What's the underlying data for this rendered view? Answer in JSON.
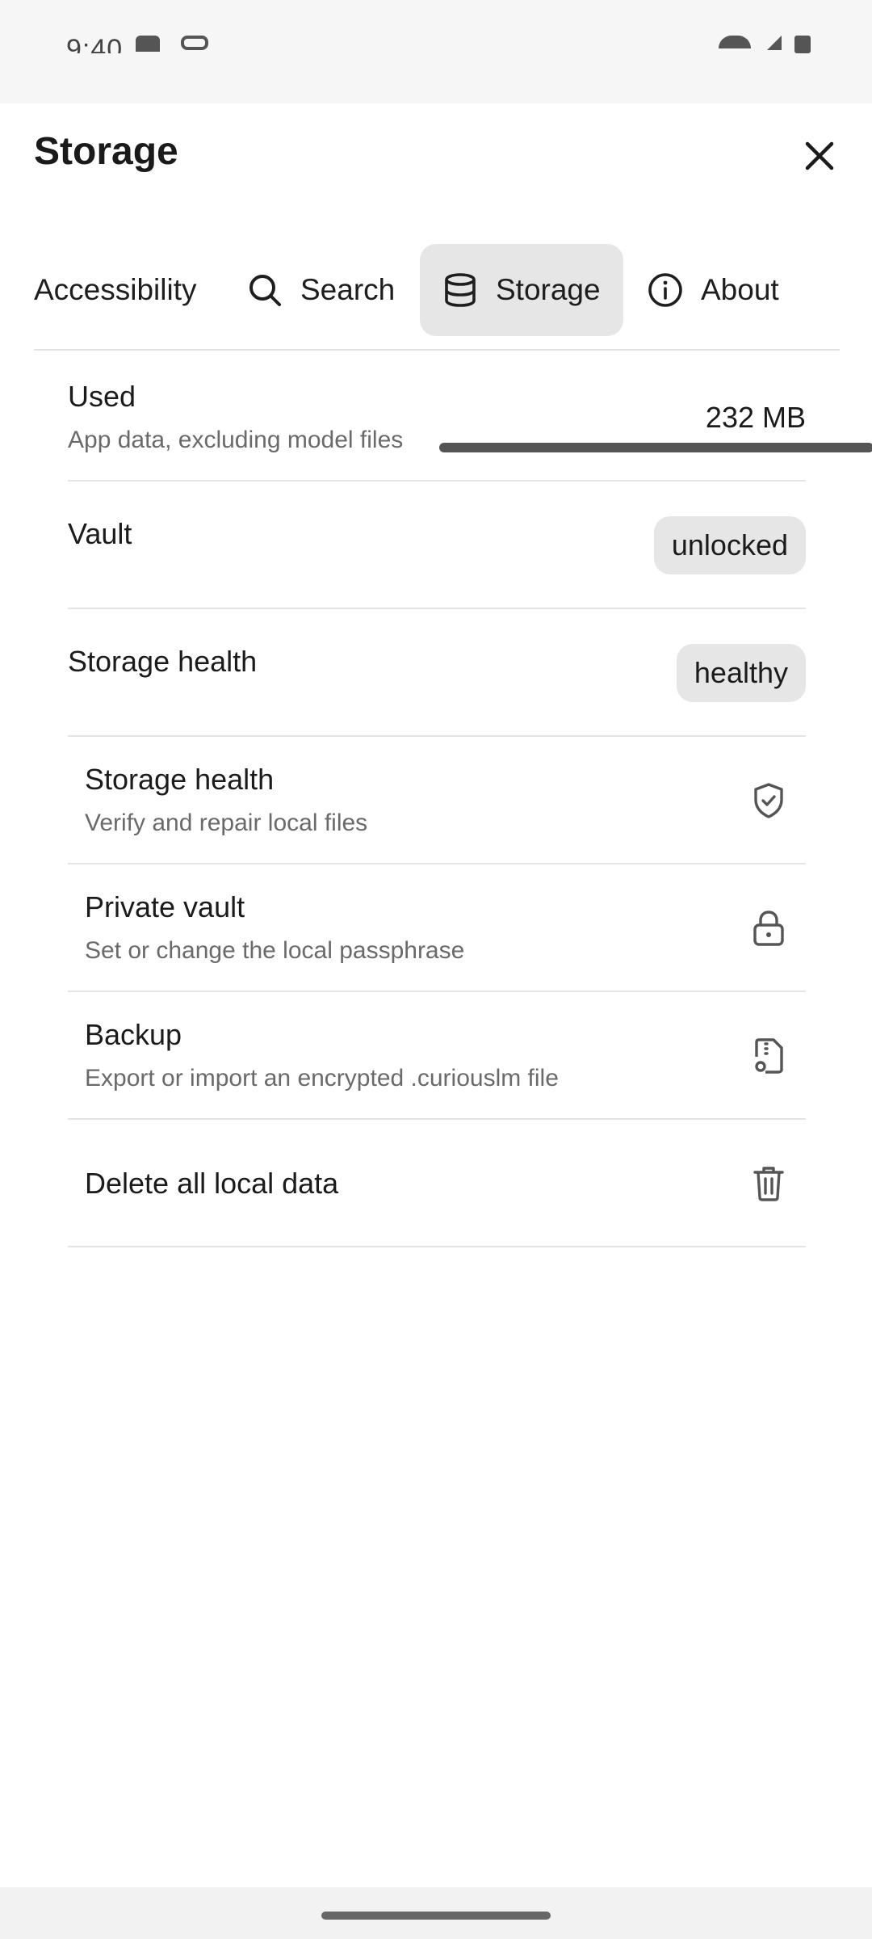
{
  "status_bar": {
    "time": "9:40"
  },
  "header": {
    "title": "Storage",
    "close_icon": "close-icon"
  },
  "tabs": [
    {
      "label": "Accessibility",
      "icon": null,
      "selected": false
    },
    {
      "label": "Search",
      "icon": "search-icon",
      "selected": false
    },
    {
      "label": "Storage",
      "icon": "database-icon",
      "selected": true
    },
    {
      "label": "About",
      "icon": "info-icon",
      "selected": false
    }
  ],
  "info": {
    "used": {
      "title": "Used",
      "subtitle": "App data, excluding model files",
      "value": "232 MB"
    },
    "vault": {
      "title": "Vault",
      "status": "unlocked"
    },
    "storage_health": {
      "title": "Storage health",
      "status": "healthy"
    }
  },
  "actions": [
    {
      "title": "Storage health",
      "subtitle": "Verify and repair local files",
      "icon": "shield-check-icon"
    },
    {
      "title": "Private vault",
      "subtitle": "Set or change the local passphrase",
      "icon": "lock-icon"
    },
    {
      "title": "Backup",
      "subtitle": "Export or import an encrypted .curiouslm file",
      "icon": "file-archive-icon"
    },
    {
      "title": "Delete all local data",
      "subtitle": "",
      "icon": "trash-icon"
    }
  ],
  "colors": {
    "selected_tab_bg": "#e6e6e6",
    "chip_bg": "#e6e6e6",
    "indicator": "#555555"
  }
}
